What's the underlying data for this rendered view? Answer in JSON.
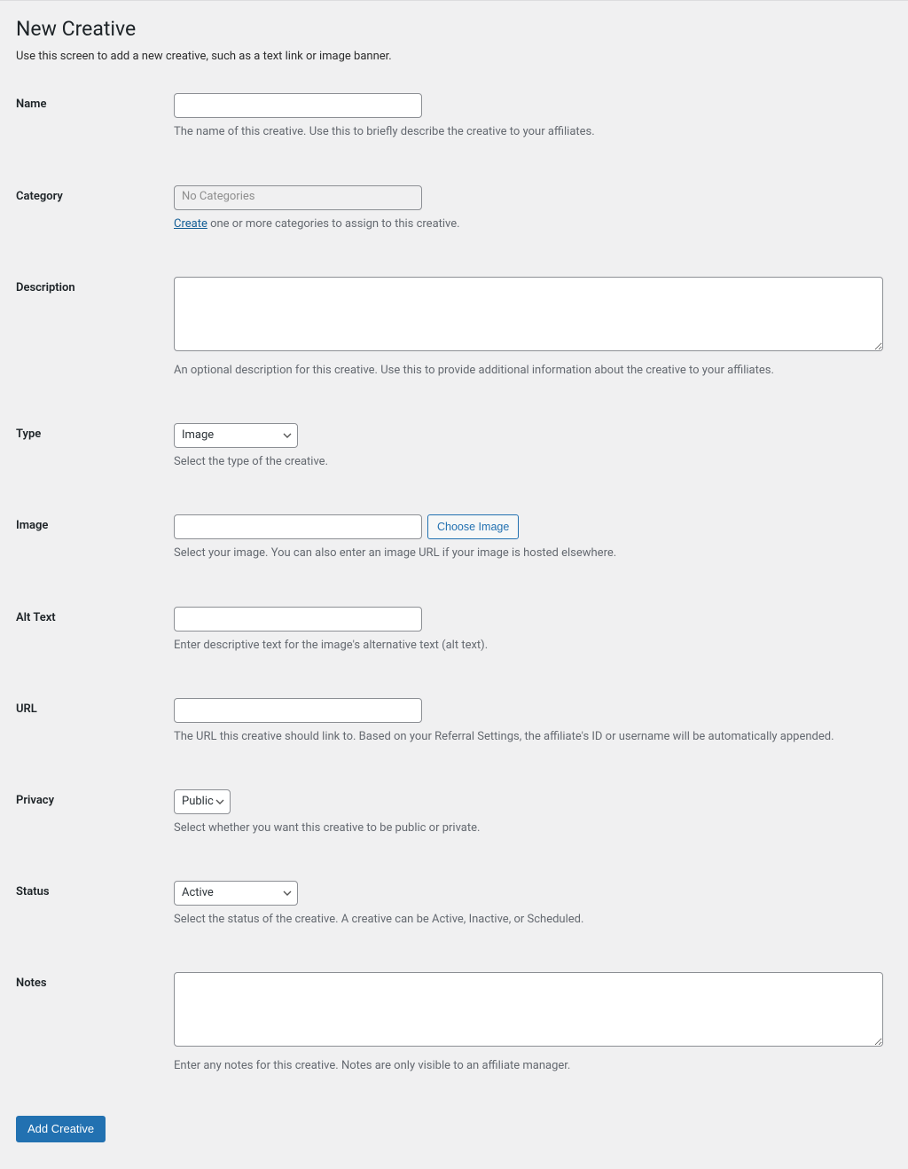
{
  "page": {
    "title": "New Creative",
    "subtitle": "Use this screen to add a new creative, such as a text link or image banner."
  },
  "fields": {
    "name": {
      "label": "Name",
      "value": "",
      "help": "The name of this creative. Use this to briefly describe the creative to your affiliates."
    },
    "category": {
      "label": "Category",
      "placeholder": "No Categories",
      "createLinkText": "Create",
      "help_suffix": " one or more categories to assign to this creative."
    },
    "description": {
      "label": "Description",
      "value": "",
      "help": "An optional description for this creative. Use this to provide additional information about the creative to your affiliates."
    },
    "type": {
      "label": "Type",
      "selected": "Image",
      "help": "Select the type of the creative."
    },
    "image": {
      "label": "Image",
      "value": "",
      "buttonLabel": "Choose Image",
      "help": "Select your image. You can also enter an image URL if your image is hosted elsewhere."
    },
    "altText": {
      "label": "Alt Text",
      "value": "",
      "help": "Enter descriptive text for the image's alternative text (alt text)."
    },
    "url": {
      "label": "URL",
      "value": "",
      "help": "The URL this creative should link to. Based on your Referral Settings, the affiliate's ID or username will be automatically appended."
    },
    "privacy": {
      "label": "Privacy",
      "selected": "Public",
      "help": "Select whether you want this creative to be public or private."
    },
    "status": {
      "label": "Status",
      "selected": "Active",
      "help": "Select the status of the creative. A creative can be Active, Inactive, or Scheduled."
    },
    "notes": {
      "label": "Notes",
      "value": "",
      "help": "Enter any notes for this creative. Notes are only visible to an affiliate manager."
    }
  },
  "buttons": {
    "submit": "Add Creative"
  }
}
